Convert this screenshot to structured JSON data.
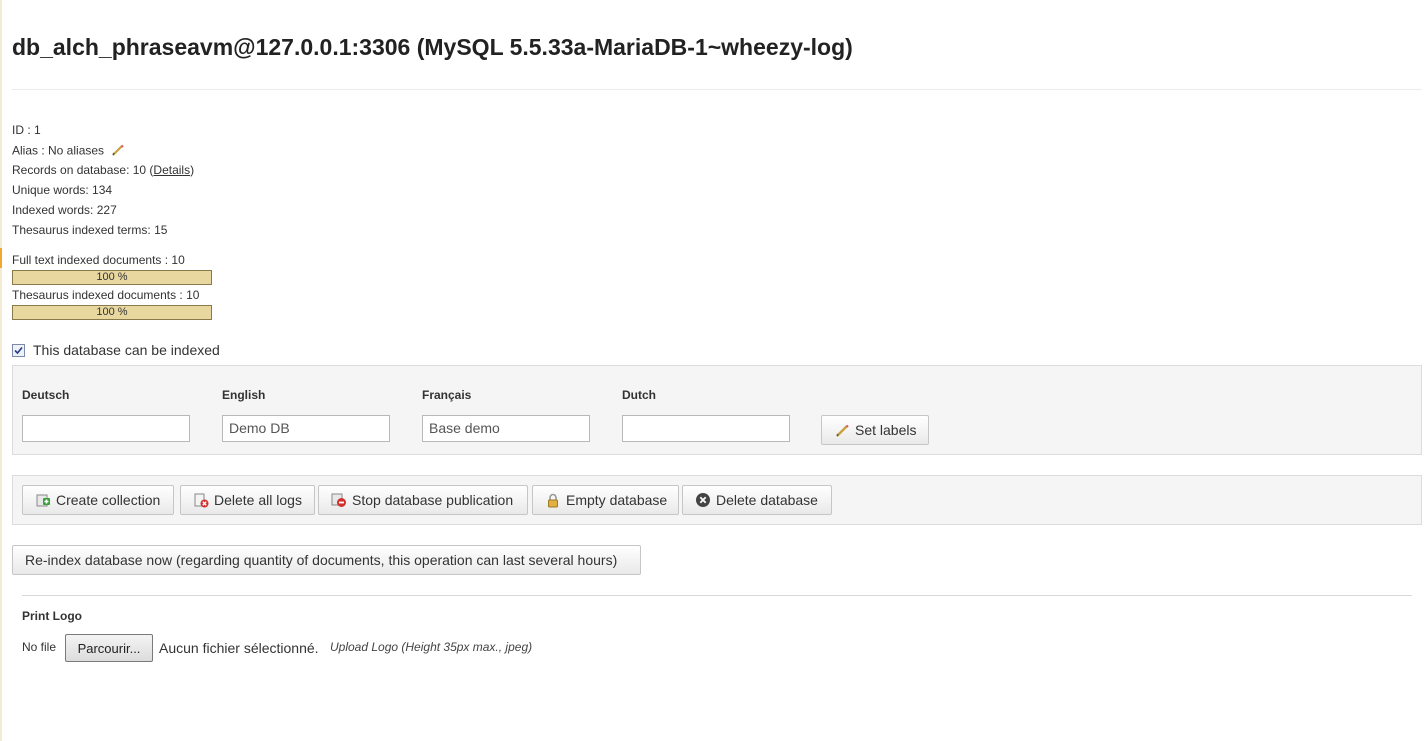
{
  "header": {
    "title": "db_alch_phraseavm@127.0.0.1:3306 (MySQL 5.5.33a-MariaDB-1~wheezy-log)"
  },
  "info": {
    "id_line": "ID : 1",
    "alias_line": "Alias : No aliases",
    "records_prefix": "Records on database: 10 (",
    "records_link": "Details",
    "records_suffix": ")",
    "unique_words": "Unique words: 134",
    "indexed_words": "Indexed words: 227",
    "thesaurus_terms": "Thesaurus indexed terms: 15",
    "fulltext_docs": "Full text indexed documents : 10",
    "fulltext_percent_label": "100 %",
    "fulltext_progress": 1.0,
    "thesaurus_docs": "Thesaurus indexed documents : 10",
    "thesaurus_percent_label": "100 %",
    "thesaurus_progress": 1.0
  },
  "indexable": {
    "label": "This database can be indexed",
    "checked": true
  },
  "labels_panel": {
    "languages": [
      {
        "label": "Deutsch",
        "value": ""
      },
      {
        "label": "English",
        "value": "Demo DB"
      },
      {
        "label": "Français",
        "value": "Base demo"
      },
      {
        "label": "Dutch",
        "value": ""
      }
    ],
    "set_labels_button": "Set labels"
  },
  "actions": {
    "create_collection": "Create collection",
    "delete_all_logs": "Delete all logs",
    "stop_publication": "Stop database publication",
    "empty_database": "Empty database",
    "delete_database": "Delete database"
  },
  "reindex_button": "Re-index database now (regarding quantity of documents, this operation can last several hours)",
  "print_logo": {
    "title": "Print Logo",
    "no_file": "No file",
    "browse_button": "Parcourir...",
    "file_status": "Aucun fichier sélectionné.",
    "upload_hint": "Upload Logo (Height 35px max., jpeg)"
  },
  "colors": {
    "progress_fill": "#e8d8a0",
    "panel_bg": "#f5f5f5",
    "accent_mark": "#f0a830"
  }
}
